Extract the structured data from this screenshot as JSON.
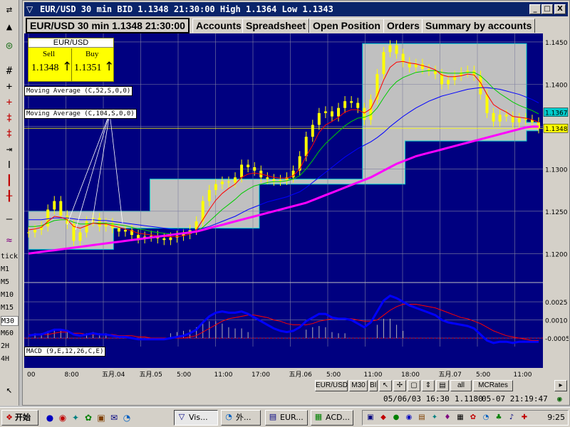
{
  "window": {
    "title": "EUR/USD 30 min BID 1.1348 21:30:00 High 1.1364 Low 1.1343",
    "minimize": "_",
    "maximize": "□",
    "close": "X"
  },
  "tabs": [
    {
      "label": "EUR/USD 30 min 1.1348 21:30:00",
      "active": true
    },
    {
      "label": "Accounts",
      "active": false
    },
    {
      "label": "Spreadsheet",
      "active": false
    },
    {
      "label": "Open Position",
      "active": false
    },
    {
      "label": "Orders",
      "active": false
    },
    {
      "label": "Summary by accounts",
      "active": false
    }
  ],
  "price_panel": {
    "pair": "EUR/USD",
    "sell_label": "Sell",
    "buy_label": "Buy",
    "sell_value": "1.1348",
    "buy_value": "1.1351",
    "arrow": "↑"
  },
  "indicators": {
    "ma1": "Moving Average (C,52,S,0,0)",
    "ma2": "Moving Average (C,104,S,0,0)",
    "macd": "MACD (9,E,12,26,C,E)"
  },
  "left_toolbar": {
    "timeframes": [
      "tick",
      "M1",
      "M5",
      "M10",
      "M15",
      "M30",
      "M60",
      "2H",
      "4H"
    ],
    "selected": "M30"
  },
  "bottom_buttons": [
    "EUR/USD",
    "M30",
    "BID",
    "all",
    "MCRates"
  ],
  "status": {
    "left": "05/06/03 16:30",
    "mid": "1.1180",
    "right": "05-07 21:19:47"
  },
  "taskbar": {
    "start_label": "开始",
    "tasks": [
      {
        "label": "Vis...",
        "active": true
      },
      {
        "label": "外...",
        "active": false
      },
      {
        "label": "EUR...",
        "active": false
      },
      {
        "label": "ACD...",
        "active": false
      }
    ],
    "clock": "9:25"
  },
  "colors": {
    "chart_bg": "#000080",
    "price_area": "#c0c0c0",
    "candles": "#ffff00",
    "ma_fast": "#ff0000",
    "ma_mid": "#00cc00",
    "ma_slow": "#0000ff",
    "ma_long": "#ff00ff",
    "macd_line": "#0000ff",
    "signal_line": "#ff0000",
    "current_price_box": "#ffff00",
    "alt_price_box": "#00cccc"
  },
  "chart_data": {
    "type": "line",
    "title": "",
    "price_axis": {
      "ticks": [
        "1.1450",
        "1.1400",
        "1.1350",
        "1.1300",
        "1.1250",
        "1.1200"
      ],
      "ylim": [
        1.117,
        1.146
      ],
      "current_price": "1.1348",
      "marker_price": "1.1367"
    },
    "macd_axis": {
      "ticks": [
        "0.0025",
        "0.0010",
        "-0.0005"
      ],
      "ylim": [
        -0.0012,
        0.0038
      ]
    },
    "x_ticks": [
      "00",
      "8:00",
      "五月.04",
      "五月.05",
      "5:00",
      "11:00",
      "17:00",
      "五月.06",
      "5:00",
      "11:00",
      "18:00",
      "五月.07",
      "5:00",
      "11:00"
    ],
    "close": [
      1.1225,
      1.1228,
      1.1232,
      1.1252,
      1.1262,
      1.1245,
      1.1235,
      1.1215,
      1.1225,
      1.1238,
      1.1242,
      1.1232,
      1.1236,
      1.123,
      1.1226,
      1.1228,
      1.1222,
      1.1218,
      1.122,
      1.1221,
      1.1218,
      1.1216,
      1.1219,
      1.1221,
      1.1223,
      1.1228,
      1.1238,
      1.1262,
      1.1275,
      1.1282,
      1.1285,
      1.1284,
      1.129,
      1.1305,
      1.1302,
      1.1298,
      1.129,
      1.1288,
      1.1286,
      1.1287,
      1.129,
      1.1298,
      1.1315,
      1.1338,
      1.1352,
      1.1366,
      1.1368,
      1.1362,
      1.1372,
      1.138,
      1.1378,
      1.1372,
      1.1358,
      1.1382,
      1.1412,
      1.1438,
      1.1446,
      1.1436,
      1.1426,
      1.142,
      1.1424,
      1.1418,
      1.1416,
      1.1412,
      1.14,
      1.1405,
      1.141,
      1.1414,
      1.1416,
      1.141,
      1.1388,
      1.1366,
      1.1356,
      1.1364,
      1.1362,
      1.1355,
      1.136,
      1.1358,
      1.1355,
      1.1348
    ],
    "ma_fast": [
      1.1228,
      1.1229,
      1.1231,
      1.1238,
      1.1244,
      1.1243,
      1.124,
      1.1232,
      1.123,
      1.1233,
      1.1236,
      1.1235,
      1.1235,
      1.1233,
      1.1231,
      1.1229,
      1.1227,
      1.1224,
      1.1223,
      1.1222,
      1.1221,
      1.122,
      1.122,
      1.122,
      1.1221,
      1.1223,
      1.1228,
      1.124,
      1.1252,
      1.1263,
      1.1271,
      1.1277,
      1.1282,
      1.129,
      1.1294,
      1.1295,
      1.1294,
      1.1292,
      1.129,
      1.1289,
      1.1289,
      1.1292,
      1.13,
      1.1315,
      1.1328,
      1.1343,
      1.1352,
      1.1356,
      1.1361,
      1.1367,
      1.137,
      1.137,
      1.1366,
      1.1371,
      1.1386,
      1.1405,
      1.142,
      1.1426,
      1.1427,
      1.1425,
      1.1424,
      1.1422,
      1.142,
      1.1417,
      1.1411,
      1.1409,
      1.1409,
      1.141,
      1.1412,
      1.1411,
      1.1402,
      1.1388,
      1.1376,
      1.1371,
      1.1367,
      1.1362,
      1.1361,
      1.136,
      1.1358,
      1.1355
    ],
    "ma_mid": [
      1.1232,
      1.1232,
      1.1233,
      1.1236,
      1.1239,
      1.124,
      1.124,
      1.1237,
      1.1235,
      1.1235,
      1.1236,
      1.1236,
      1.1236,
      1.1235,
      1.1234,
      1.1233,
      1.1231,
      1.1229,
      1.1228,
      1.1226,
      1.1225,
      1.1224,
      1.1223,
      1.1223,
      1.1223,
      1.1224,
      1.1226,
      1.1231,
      1.1238,
      1.1245,
      1.1252,
      1.1258,
      1.1264,
      1.1271,
      1.1276,
      1.128,
      1.1282,
      1.1284,
      1.1285,
      1.1285,
      1.1286,
      1.1288,
      1.1292,
      1.13,
      1.131,
      1.1321,
      1.133,
      1.1337,
      1.1344,
      1.1351,
      1.1356,
      1.136,
      1.1361,
      1.1364,
      1.1372,
      1.1384,
      1.1395,
      1.1403,
      1.1408,
      1.1411,
      1.1414,
      1.1415,
      1.1416,
      1.1416,
      1.1414,
      1.1413,
      1.1413,
      1.1413,
      1.1414,
      1.1414,
      1.141,
      1.1403,
      1.1395,
      1.1389,
      1.1384,
      1.1379,
      1.1375,
      1.1372,
      1.1369,
      1.1365
    ],
    "ma_slow": [
      1.124,
      1.124,
      1.124,
      1.1241,
      1.1242,
      1.1242,
      1.1242,
      1.1241,
      1.124,
      1.124,
      1.124,
      1.1239,
      1.1239,
      1.1238,
      1.1237,
      1.1236,
      1.1235,
      1.1234,
      1.1233,
      1.1232,
      1.1231,
      1.123,
      1.1229,
      1.1228,
      1.1228,
      1.1228,
      1.1228,
      1.123,
      1.1232,
      1.1235,
      1.1238,
      1.1241,
      1.1244,
      1.1248,
      1.1252,
      1.1255,
      1.1258,
      1.1261,
      1.1263,
      1.1265,
      1.1267,
      1.127,
      1.1273,
      1.1278,
      1.1284,
      1.129,
      1.1296,
      1.1302,
      1.1308,
      1.1314,
      1.1319,
      1.1324,
      1.1328,
      1.1332,
      1.1337,
      1.1343,
      1.135,
      1.1356,
      1.1362,
      1.1367,
      1.1372,
      1.1376,
      1.138,
      1.1383,
      1.1386,
      1.1388,
      1.139,
      1.1392,
      1.1394,
      1.1395,
      1.1396,
      1.1396,
      1.1395,
      1.1394,
      1.1392,
      1.139,
      1.1388,
      1.1385,
      1.1382,
      1.1378
    ],
    "ma_long": [
      1.12,
      1.1201,
      1.1202,
      1.1203,
      1.1204,
      1.1205,
      1.1206,
      1.1207,
      1.1208,
      1.1209,
      1.121,
      1.1211,
      1.1212,
      1.1213,
      1.1214,
      1.1215,
      1.1216,
      1.1217,
      1.1218,
      1.1219,
      1.122,
      1.1221,
      1.1222,
      1.1223,
      1.1224,
      1.1225,
      1.1226,
      1.1228,
      1.123,
      1.1232,
      1.1234,
      1.1236,
      1.1238,
      1.124,
      1.1242,
      1.1244,
      1.1246,
      1.1248,
      1.125,
      1.1252,
      1.1254,
      1.1256,
      1.1258,
      1.126,
      1.1263,
      1.1266,
      1.1269,
      1.1272,
      1.1275,
      1.1278,
      1.1281,
      1.1284,
      1.1287,
      1.129,
      1.1294,
      1.1298,
      1.1302,
      1.1306,
      1.1309,
      1.1312,
      1.1315,
      1.1317,
      1.1319,
      1.1321,
      1.1323,
      1.1325,
      1.1327,
      1.1329,
      1.1331,
      1.1333,
      1.1335,
      1.1337,
      1.1339,
      1.1341,
      1.1343,
      1.1345,
      1.1347,
      1.1349,
      1.135,
      1.135
    ],
    "macd": [
      -0.0003,
      -0.0002,
      -0.0002,
      0.0,
      0.0002,
      0.0002,
      0.0001,
      -0.0002,
      -0.0003,
      -0.0002,
      -0.0001,
      -0.0002,
      -0.0002,
      -0.0003,
      -0.0004,
      -0.0004,
      -0.0005,
      -0.0006,
      -0.0006,
      -0.0006,
      -0.0006,
      -0.0006,
      -0.0005,
      -0.0004,
      -0.0003,
      -0.0001,
      0.0002,
      0.0008,
      0.0013,
      0.0016,
      0.0017,
      0.0016,
      0.0016,
      0.0017,
      0.0015,
      0.0012,
      0.0009,
      0.0006,
      0.0003,
      0.0001,
      0.0,
      0.0001,
      0.0004,
      0.0009,
      0.0012,
      0.0015,
      0.0015,
      0.0012,
      0.0011,
      0.0011,
      0.001,
      0.0007,
      0.0004,
      0.0008,
      0.0017,
      0.0026,
      0.003,
      0.0028,
      0.0025,
      0.0022,
      0.002,
      0.0018,
      0.0016,
      0.0014,
      0.001,
      0.0008,
      0.0007,
      0.0006,
      0.0005,
      0.0003,
      -0.0002,
      -0.0007,
      -0.0009,
      -0.0008,
      -0.0008,
      -0.0009,
      -0.0008,
      -0.0008,
      -0.0008,
      -0.0008
    ],
    "signal": [
      -0.0002,
      -0.0002,
      -0.0002,
      -0.0002,
      -0.0001,
      0.0,
      0.0,
      -0.0001,
      -0.0001,
      -0.0002,
      -0.0002,
      -0.0002,
      -0.0002,
      -0.0002,
      -0.0003,
      -0.0003,
      -0.0003,
      -0.0004,
      -0.0004,
      -0.0005,
      -0.0005,
      -0.0005,
      -0.0005,
      -0.0005,
      -0.0005,
      -0.0004,
      -0.0003,
      0.0,
      0.0003,
      0.0006,
      0.0009,
      0.0011,
      0.0012,
      0.0013,
      0.0014,
      0.0014,
      0.0013,
      0.0012,
      0.001,
      0.0009,
      0.0007,
      0.0006,
      0.0006,
      0.0006,
      0.0007,
      0.0009,
      0.001,
      0.0011,
      0.0011,
      0.0011,
      0.0011,
      0.001,
      0.0009,
      0.0009,
      0.001,
      0.0014,
      0.0018,
      0.0021,
      0.0023,
      0.0023,
      0.0023,
      0.0022,
      0.0021,
      0.002,
      0.0018,
      0.0016,
      0.0014,
      0.0012,
      0.0011,
      0.0009,
      0.0007,
      0.0004,
      0.0001,
      -0.0001,
      -0.0003,
      -0.0004,
      -0.0005,
      -0.0006,
      -0.0007,
      -0.0007
    ]
  }
}
